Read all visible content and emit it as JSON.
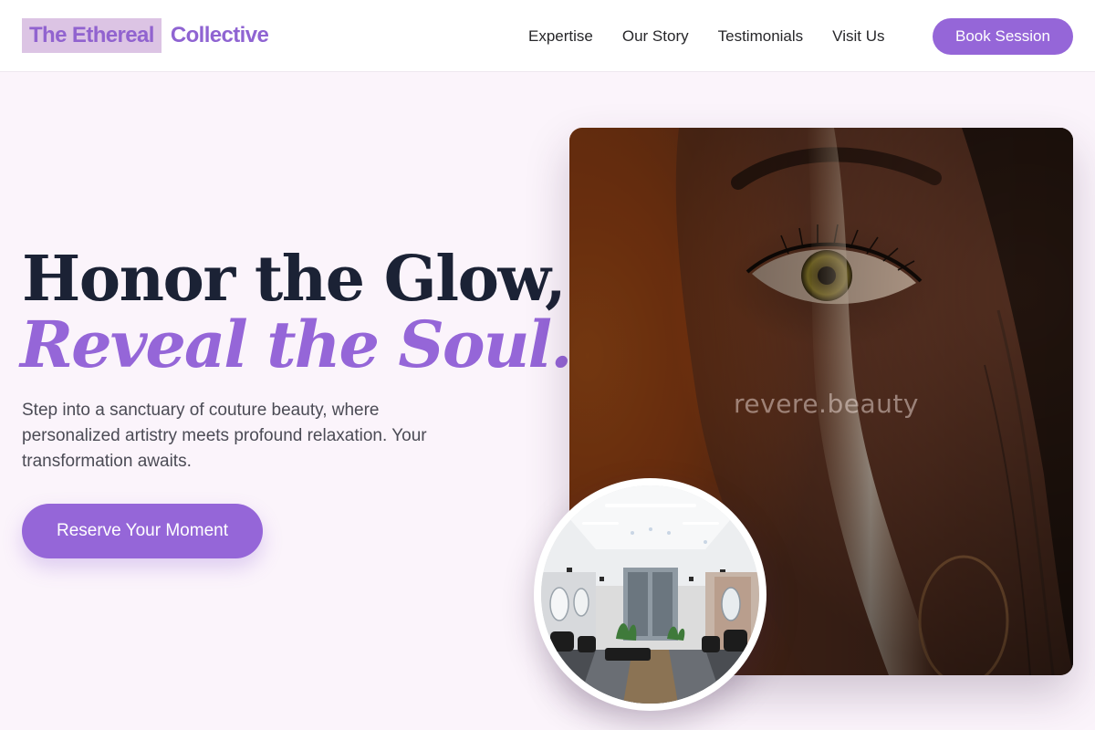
{
  "brand": {
    "name_highlight": "The Ethereal",
    "name_rest": "Collective"
  },
  "nav": {
    "links": [
      "Expertise",
      "Our Story",
      "Testimonials",
      "Visit Us"
    ],
    "cta_label": "Book Session"
  },
  "hero": {
    "title_line1": "Honor the Glow,",
    "title_line2": "Reveal the Soul.",
    "description": "Step into a sanctuary of couture beauty, where personalized artistry meets profound relaxation. Your transformation awaits.",
    "cta_label": "Reserve Your Moment"
  },
  "images": {
    "portrait_watermark": "revere.beauty"
  },
  "colors": {
    "accent": "#9566d8",
    "logo_highlight_bg": "#dcc4e4",
    "heading_dark": "#1b2235",
    "page_bg": "#fbf4fb"
  }
}
